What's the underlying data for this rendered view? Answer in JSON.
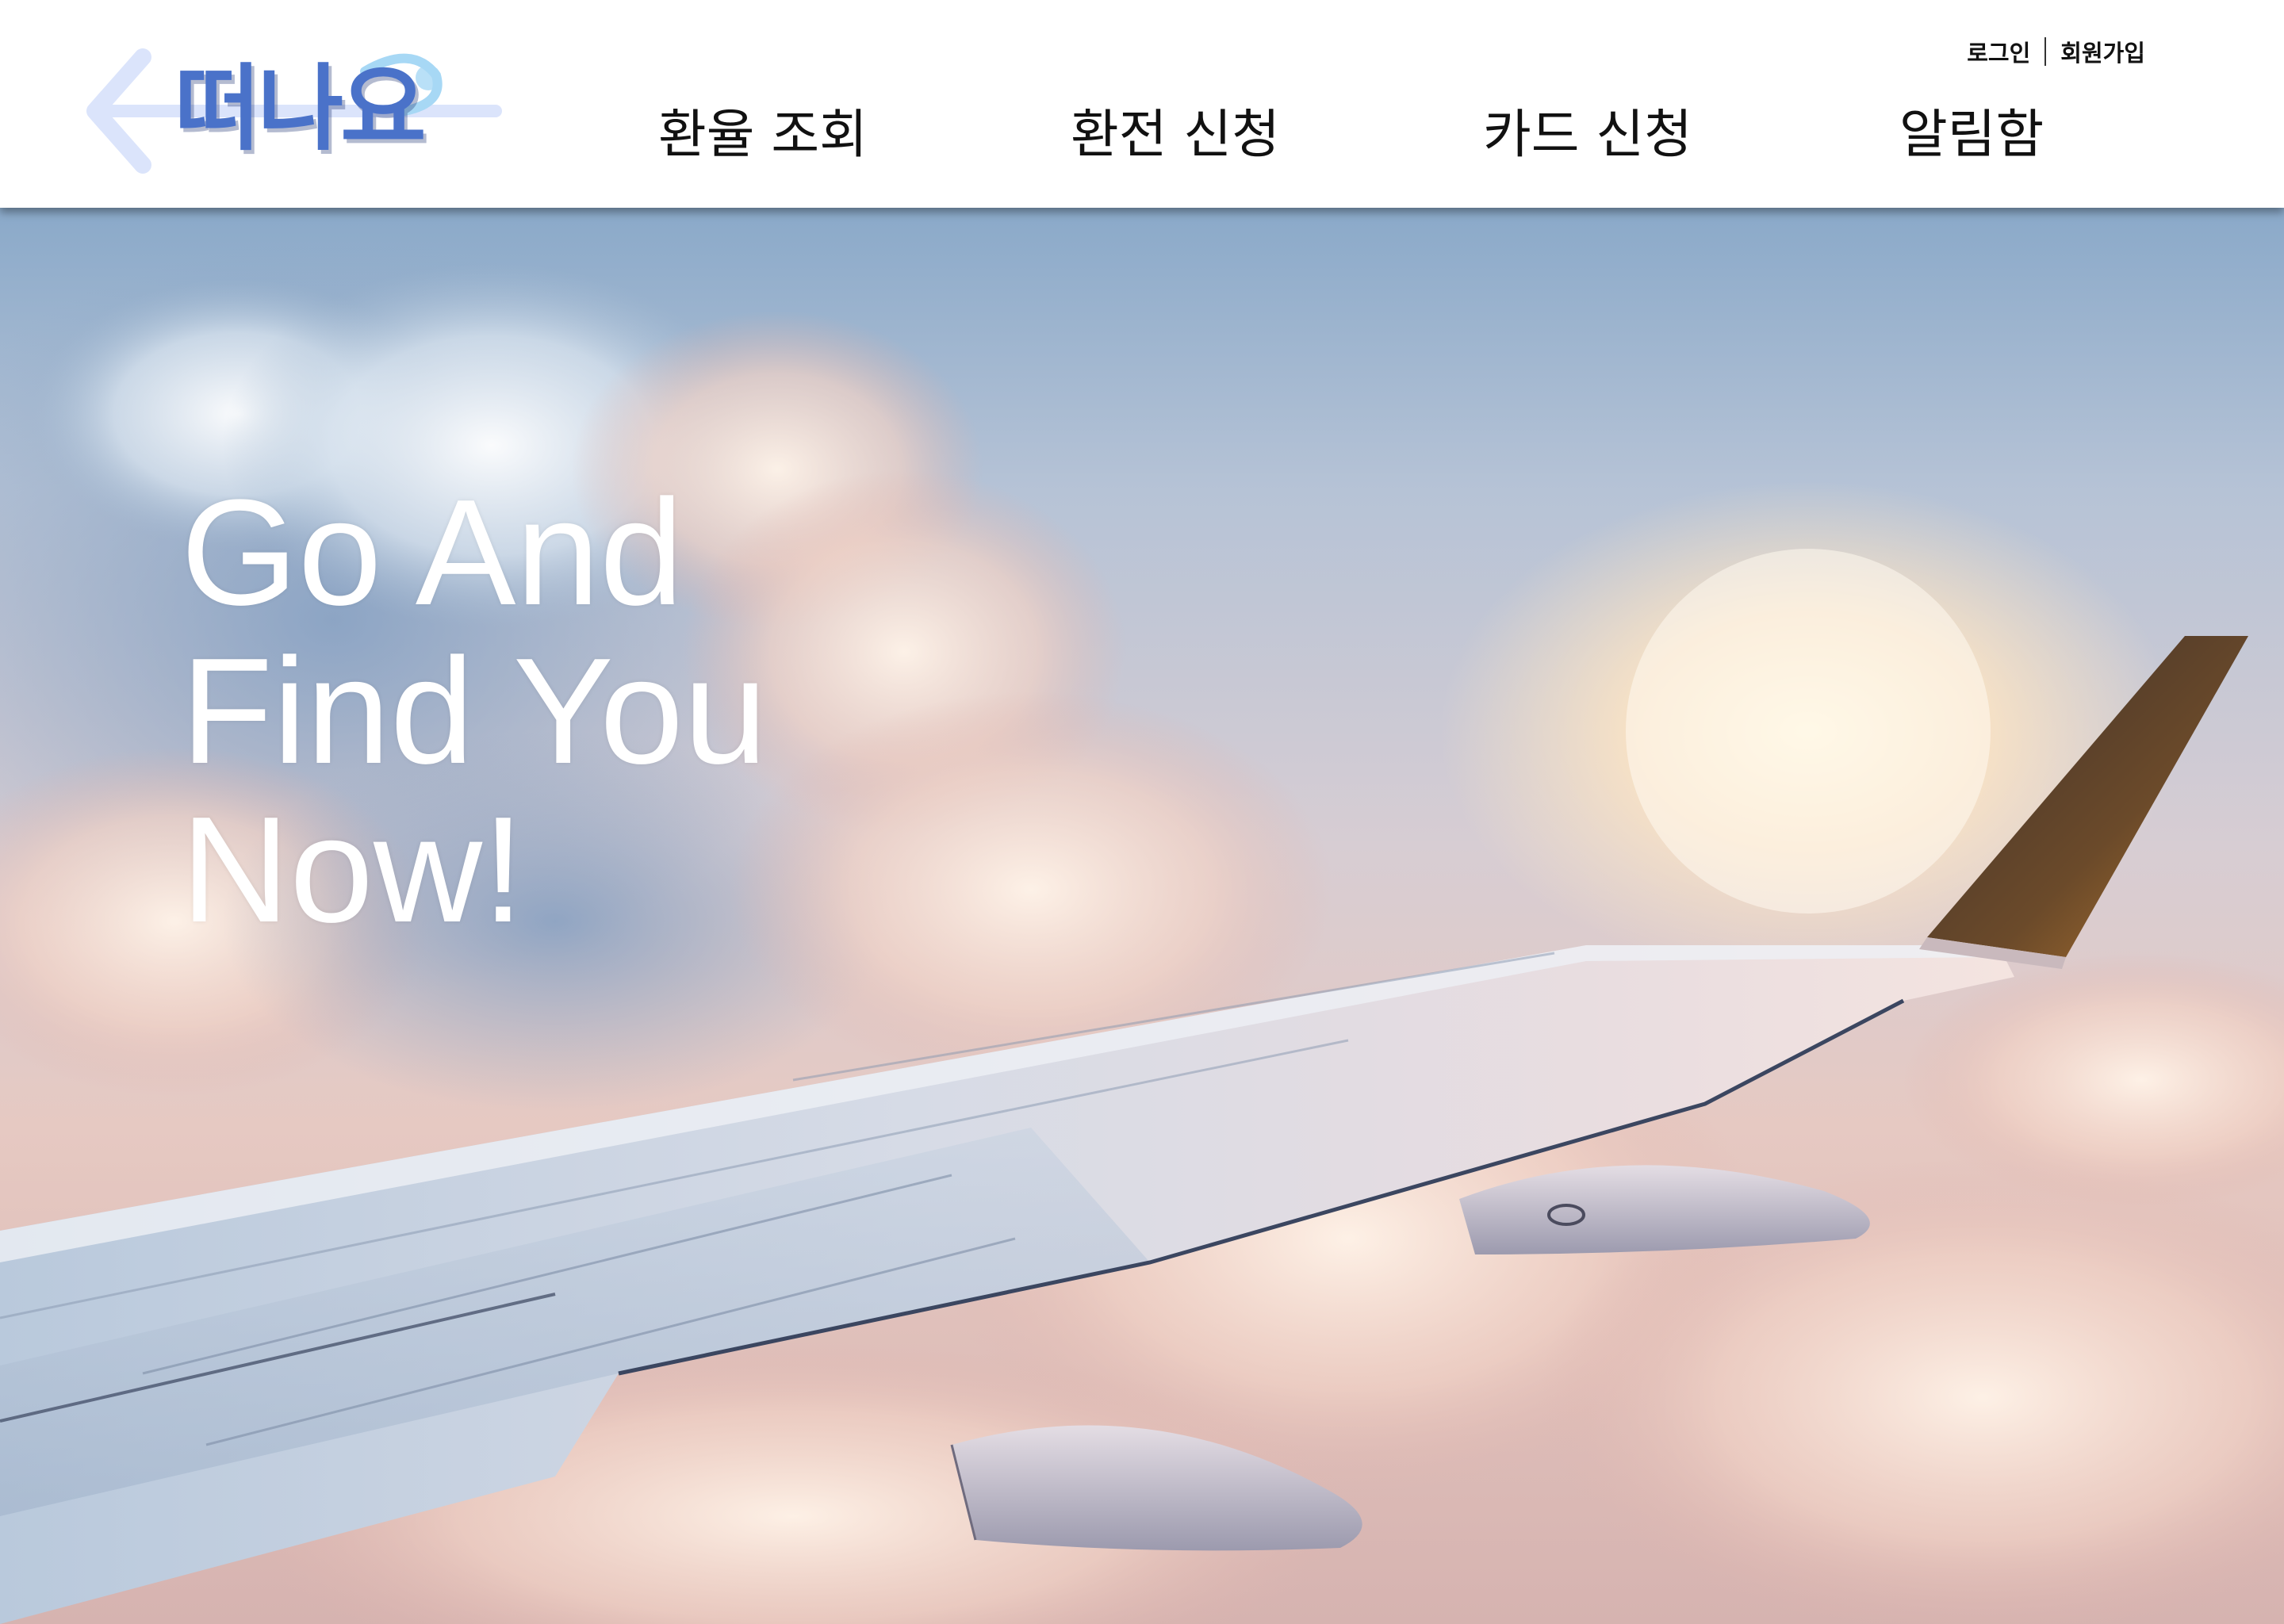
{
  "brand": {
    "logo_text": "떠나요",
    "accent_color": "#4a72c9",
    "arrow_color": "#dbe4fb",
    "icon": "back-arrow-icon"
  },
  "auth": {
    "login_label": "로그인",
    "signup_label": "회원가입"
  },
  "nav": {
    "items": [
      {
        "label": "환율 조회"
      },
      {
        "label": "환전 신청"
      },
      {
        "label": "카드 신청"
      },
      {
        "label": "알림함"
      }
    ]
  },
  "hero": {
    "headline_lines": [
      "Go And",
      "Find You",
      "Now!"
    ],
    "headline_color": "#ffffff",
    "image": "airplane-wing-above-clouds"
  }
}
